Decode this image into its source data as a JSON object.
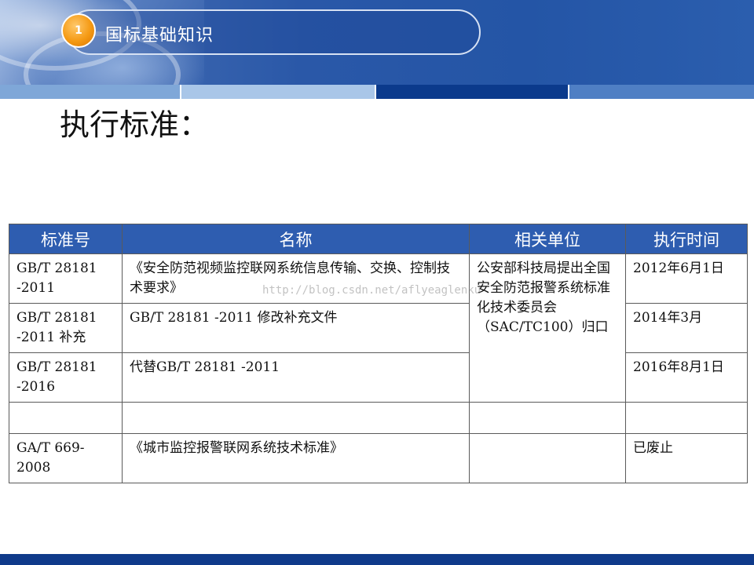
{
  "header": {
    "badge_number": "1",
    "section_title": "国标基础知识"
  },
  "heading": "执行标准：",
  "table": {
    "columns": [
      "标准号",
      "名称",
      "相关单位",
      "执行时间"
    ],
    "rows": [
      {
        "std": "GB/T 28181 -2011",
        "name": "《安全防范视频监控联网系统信息传输、交换、控制技术要求》",
        "time": "2012年6月1日"
      },
      {
        "std": "GB/T 28181 -2011 补充",
        "name": "GB/T 28181 -2011 修改补充文件",
        "time": "2014年3月"
      },
      {
        "std": "GB/T 28181 -2016",
        "name": "代替GB/T 28181 -2011",
        "time": "2016年8月1日"
      },
      {
        "std": "",
        "name": "",
        "unit": "",
        "time": ""
      },
      {
        "std": "GA/T 669-2008",
        "name": "《城市监控报警联网系统技术标准》",
        "unit": "",
        "time": "已废止"
      }
    ],
    "merged_unit": "公安部科技局提出全国安全防范报警系统标准化技术委员会（SAC/TC100）归口"
  },
  "watermark": "http://blog.csdn.net/aflyeaglenku",
  "colors": {
    "header_blue": "#2455a6",
    "badge_orange": "#f59a14",
    "table_header": "#2e5db0",
    "footer": "#0f3a8a"
  }
}
